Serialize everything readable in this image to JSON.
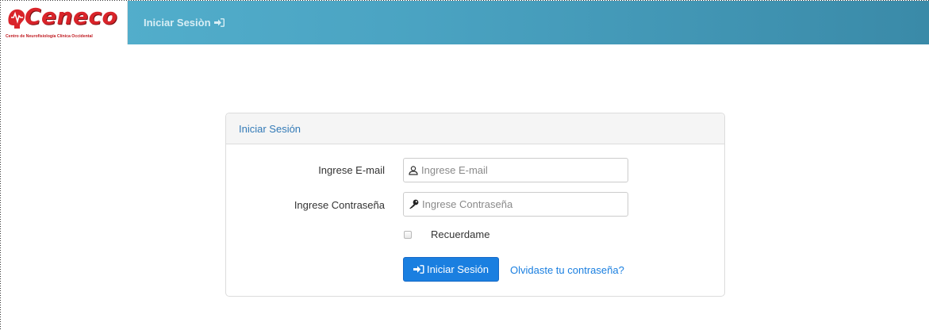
{
  "brand": {
    "name": "Ceneco",
    "subtitle": "Centro de Neurofisiología Clínica Occidental"
  },
  "nav": {
    "login_link": "Iniciar Sesiòn",
    "login_icon": "sign-in-icon"
  },
  "panel": {
    "heading": "Iniciar Sesión",
    "email": {
      "label": "Ingrese E-mail",
      "placeholder": "Ingrese E-mail",
      "icon": "user-icon"
    },
    "password": {
      "label": "Ingrese Contraseña",
      "placeholder": "Ingrese Contraseña",
      "icon": "key-icon"
    },
    "remember_label": "Recuerdame",
    "submit_label": "Iniciar Sesión",
    "submit_icon": "sign-in-icon",
    "forgot_label": "Olvidaste tu contraseña?"
  },
  "colors": {
    "navbar_start": "#55b2cf",
    "navbar_end": "#3a8aa8",
    "brand_red": "#d9242a",
    "primary": "#1a7fe0",
    "link": "#1a7fe0",
    "panel_heading_text": "#337ab7"
  }
}
